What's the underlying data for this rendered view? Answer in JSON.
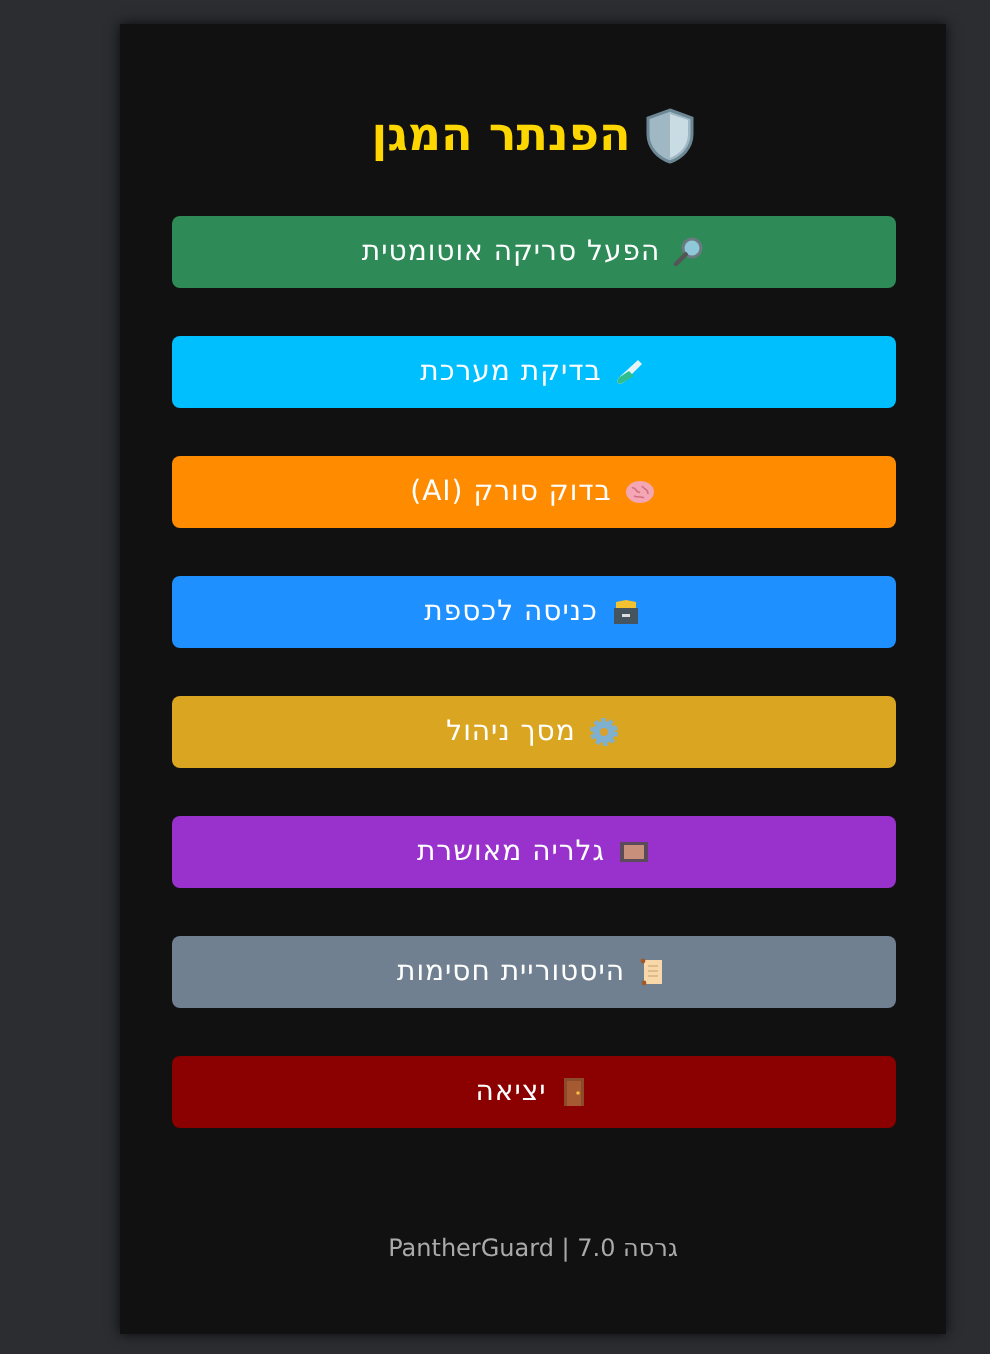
{
  "title": "הפנתר המגן",
  "buttons": [
    {
      "label": "הפעל סריקה אוטומטית",
      "kind": "magnifier",
      "color": "#2e8b57"
    },
    {
      "label": "בדיקת מערכת",
      "kind": "testtube",
      "color": "#00bfff"
    },
    {
      "label": "בדוק סורק (AI)",
      "kind": "brain",
      "color": "#ff8c00"
    },
    {
      "label": "כניסה לכספת",
      "kind": "cabinet",
      "color": "#1e90ff"
    },
    {
      "label": "מסך ניהול",
      "kind": "gear",
      "color": "#daa520"
    },
    {
      "label": "גלריה מאושרת",
      "kind": "film",
      "color": "#9932cc"
    },
    {
      "label": "היסטוריית חסימות",
      "kind": "scroll",
      "color": "#708090"
    },
    {
      "label": "יציאה",
      "kind": "door",
      "color": "#8b0000"
    }
  ],
  "footer": "גרסה 7.0 | PantherGuard"
}
